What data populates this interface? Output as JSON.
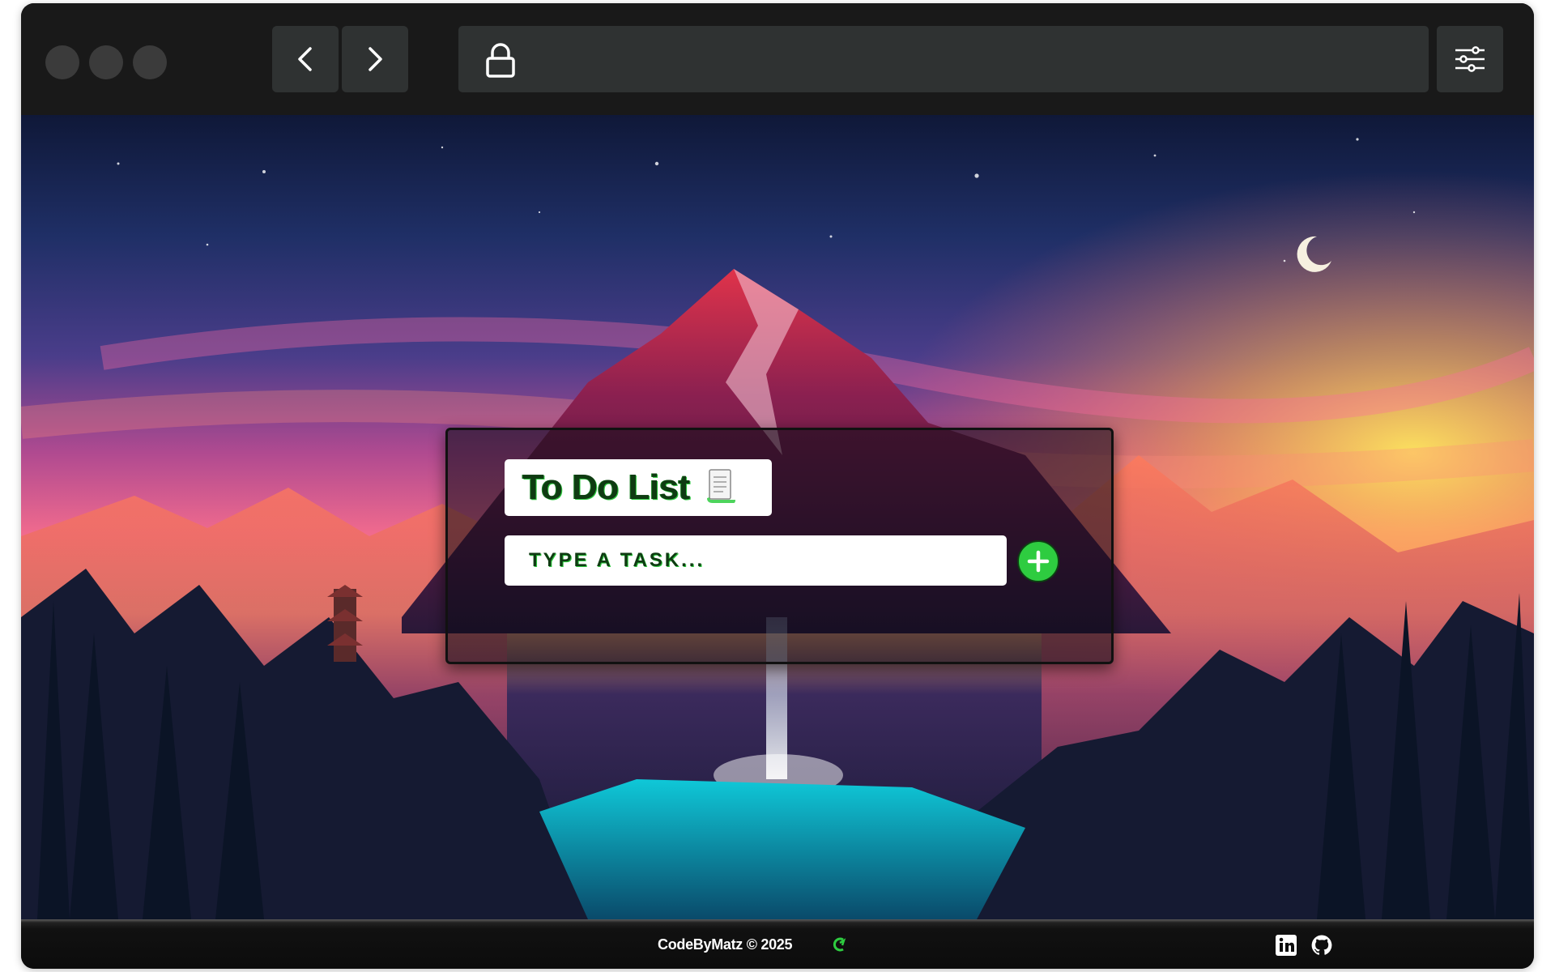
{
  "browser": {
    "window_controls": [
      "close",
      "minimize",
      "maximize"
    ],
    "back_icon": "chevron-left-icon",
    "forward_icon": "chevron-right-icon",
    "address_icon": "lock-icon",
    "address_text": "",
    "settings_icon": "sliders-icon"
  },
  "app": {
    "title": "To Do List",
    "title_icon": "scroll-icon",
    "input_placeholder": "TYPE A TASK...",
    "input_value": "",
    "add_button_icon": "plus-icon",
    "tasks": []
  },
  "footer": {
    "credit": "CodeByMatz © 2025",
    "logo_icon": "codebymatz-logo-icon",
    "links": [
      "linkedin-icon",
      "github-icon"
    ]
  },
  "colors": {
    "accent_green": "#2ecc40",
    "title_text": "#0f3b12",
    "chrome_bg": "#191919",
    "chrome_button": "#2f3232"
  }
}
